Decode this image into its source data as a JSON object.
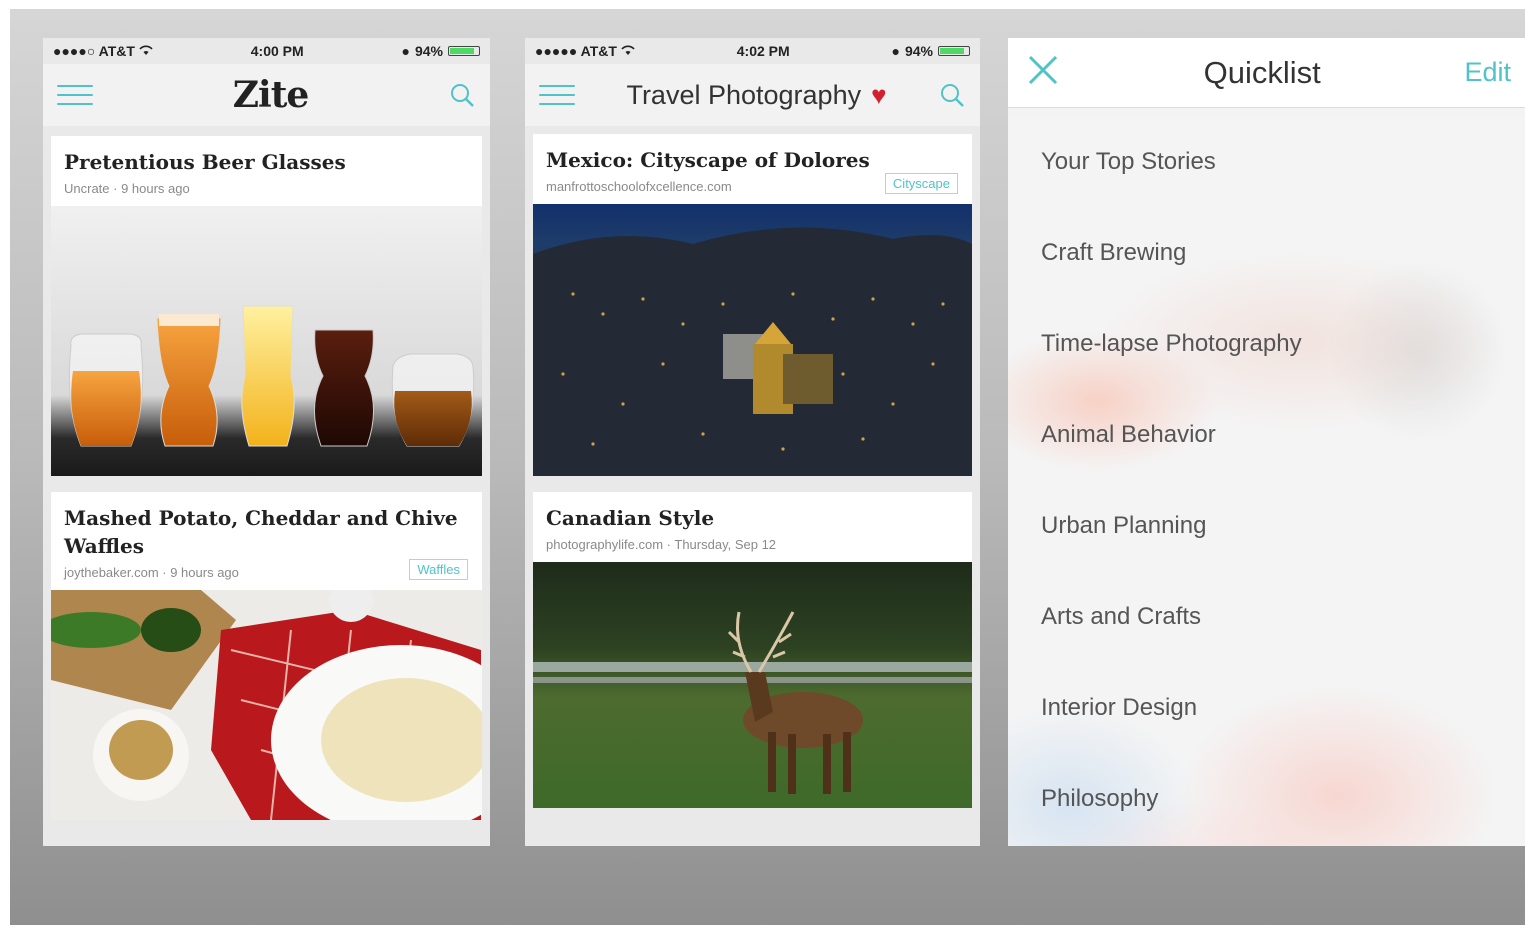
{
  "phone1": {
    "status": {
      "carrier": "●●●●○ AT&T",
      "time": "4:00 PM",
      "battery": "94%"
    },
    "nav": {
      "logo": "Zite"
    },
    "cards": [
      {
        "title": "Pretentious Beer Glasses",
        "meta": "Uncrate · 9 hours ago",
        "tag": ""
      },
      {
        "title": "Mashed Potato, Cheddar and Chive Waffles",
        "meta": "joythebaker.com · 9 hours ago",
        "tag": "Waffles"
      }
    ]
  },
  "phone2": {
    "status": {
      "carrier": "●●●●● AT&T",
      "time": "4:02 PM",
      "battery": "94%"
    },
    "nav": {
      "title": "Travel Photography"
    },
    "cards": [
      {
        "title": "Mexico: Cityscape of Dolores",
        "meta": "manfrottoschoolofxcellence.com",
        "tag": "Cityscape"
      },
      {
        "title": "Canadian Style",
        "meta": "photographylife.com · Thursday, Sep 12",
        "tag": ""
      }
    ]
  },
  "quicklist": {
    "title": "Quicklist",
    "edit_label": "Edit",
    "items": [
      "Your Top Stories",
      "Craft Brewing",
      "Time-lapse Photography",
      "Animal Behavior",
      "Urban Planning",
      "Arts and Crafts",
      "Interior Design",
      "Philosophy"
    ]
  },
  "colors": {
    "accent": "#4fc3c8",
    "heart": "#d3202f"
  },
  "icons": [
    "hamburger-menu-icon",
    "search-icon",
    "heart-icon",
    "close-icon",
    "wifi-icon",
    "battery-icon"
  ]
}
